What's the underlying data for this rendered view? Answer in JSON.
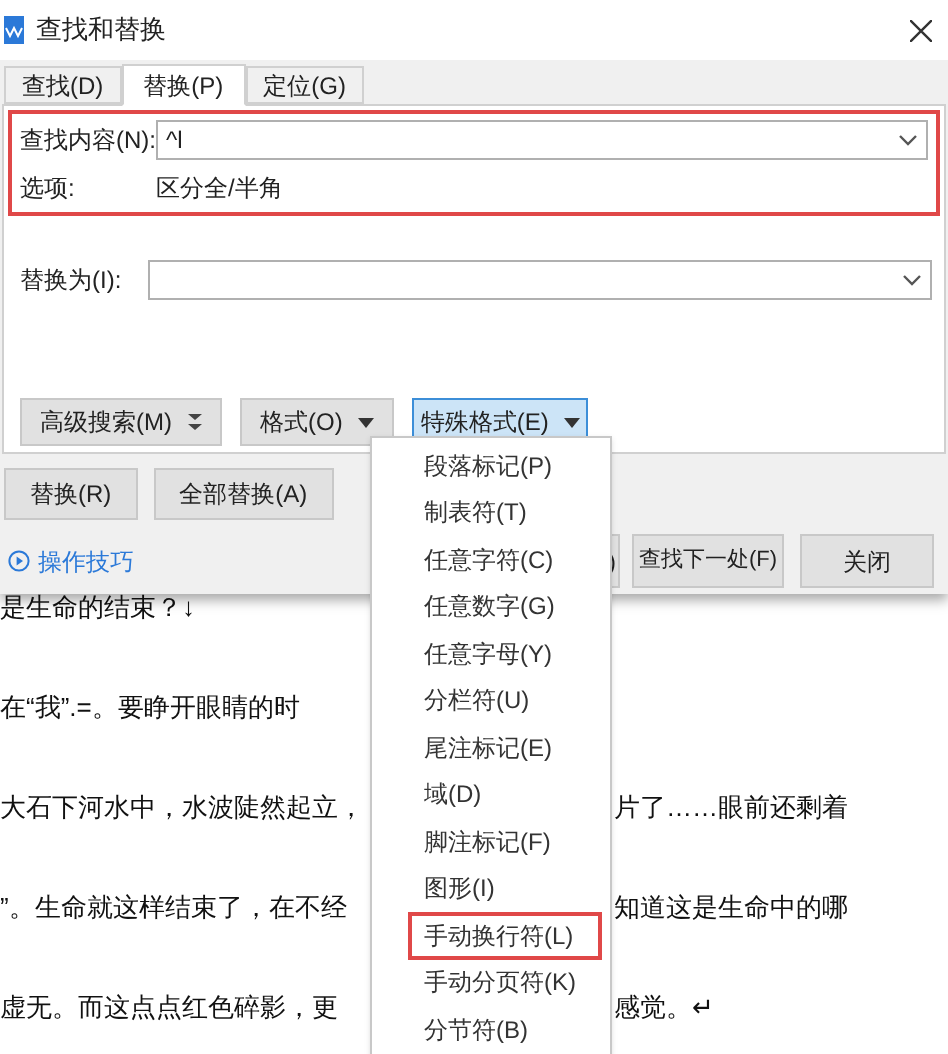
{
  "window": {
    "title": "查找和替换"
  },
  "tabs": [
    {
      "label": "查找(D)",
      "selected": false
    },
    {
      "label": "替换(P)",
      "selected": true
    },
    {
      "label": "定位(G)",
      "selected": false
    }
  ],
  "find_section": {
    "highlighted": true,
    "label": "查找内容(N):",
    "value": "^l",
    "options_label": "选项:",
    "options_value": "区分全/半角"
  },
  "replace": {
    "label": "替换为(I):"
  },
  "option_buttons": [
    {
      "label": "高级搜索(M)",
      "kind": "expand",
      "selected": false
    },
    {
      "label": "格式(O)",
      "kind": "dropdown",
      "selected": false
    },
    {
      "label": "特殊格式(E)",
      "kind": "dropdown",
      "selected": true
    }
  ],
  "action_buttons": [
    "替换(R)",
    "全部替换(A)"
  ],
  "tips_link": "操作技巧",
  "nav_buttons": [
    ")",
    "查找下一处(F)",
    "关闭"
  ],
  "special_menu": [
    {
      "label": "段落标记(P)",
      "highlighted": false
    },
    {
      "label": "制表符(T)",
      "highlighted": false
    },
    {
      "label": "任意字符(C)",
      "highlighted": false
    },
    {
      "label": "任意数字(G)",
      "highlighted": false
    },
    {
      "label": "任意字母(Y)",
      "highlighted": false
    },
    {
      "label": "分栏符(U)",
      "highlighted": false
    },
    {
      "label": "尾注标记(E)",
      "highlighted": false
    },
    {
      "label": "域(D)",
      "highlighted": false
    },
    {
      "label": "脚注标记(F)",
      "highlighted": false
    },
    {
      "label": "图形(I)",
      "highlighted": false
    },
    {
      "label": "手动换行符(L)",
      "highlighted": true
    },
    {
      "label": "手动分页符(K)",
      "highlighted": false
    },
    {
      "label": "分节符(B)",
      "highlighted": false
    }
  ],
  "document_lines": [
    {
      "left": "是生命的结束？↓"
    },
    {
      "left": "在“我”.=。要睁开眼睛的时"
    },
    {
      "left": "大石下河水中，水波陡然起立，",
      "right": "片了……眼前还剩着"
    },
    {
      "left": "”。生命就这样结束了，在不经",
      "right": "知道这是生命中的哪"
    },
    {
      "left": "虚无。而这点点红色碎影，更",
      "right": "感觉。↵"
    }
  ]
}
